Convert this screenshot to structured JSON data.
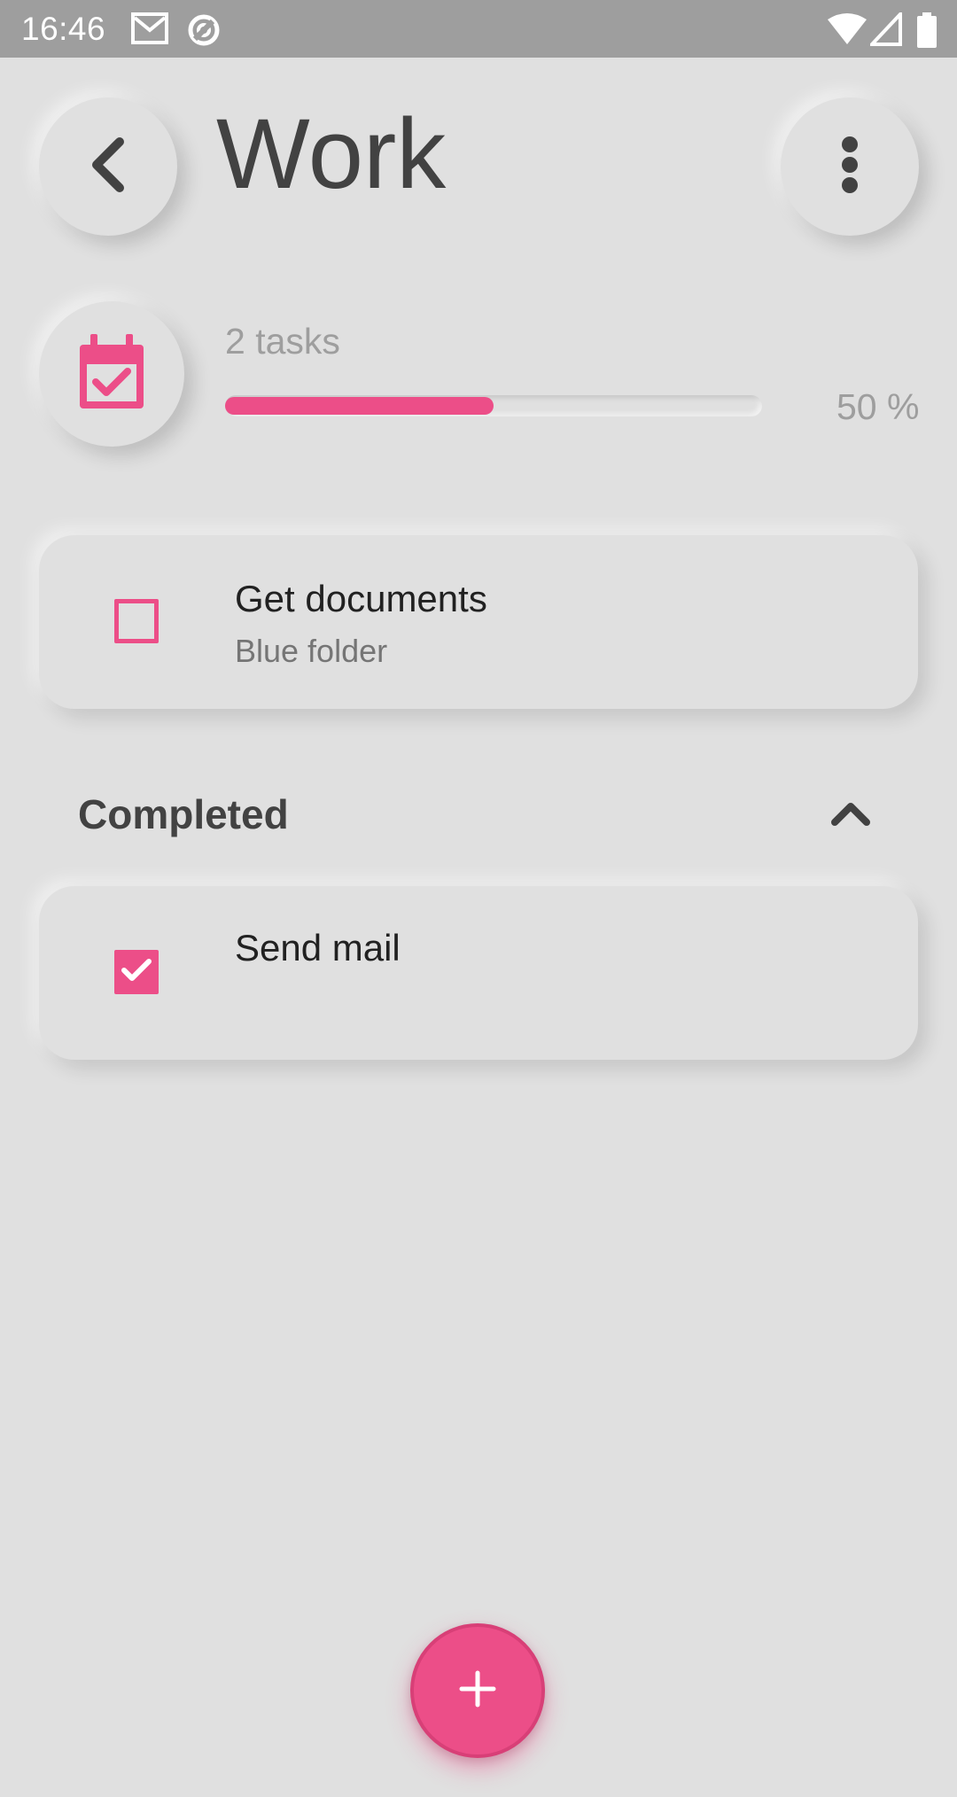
{
  "status_bar": {
    "time": "16:46",
    "icons": [
      "gmail-icon",
      "data-saver-icon",
      "wifi-icon",
      "signal-icon",
      "battery-icon"
    ]
  },
  "header": {
    "title": "Work",
    "back_icon": "chevron-left-icon",
    "menu_icon": "more-vertical-icon"
  },
  "summary": {
    "icon": "calendar-check-icon",
    "tasks_label": "2 tasks",
    "progress_fraction": 0.5,
    "progress_label": "50 %"
  },
  "tasks": [
    {
      "title": "Get documents",
      "subtitle": "Blue folder",
      "done": false
    }
  ],
  "completed_section": {
    "title": "Completed",
    "toggle_icon": "chevron-up-icon",
    "tasks": [
      {
        "title": "Send mail",
        "done": true
      }
    ]
  },
  "fab": {
    "icon": "plus-icon"
  },
  "colors": {
    "accent": "#ec4e88",
    "background": "#e0e0e0",
    "status_bar": "#9e9e9e",
    "text_primary": "#424242",
    "text_muted": "#9e9e9e"
  }
}
